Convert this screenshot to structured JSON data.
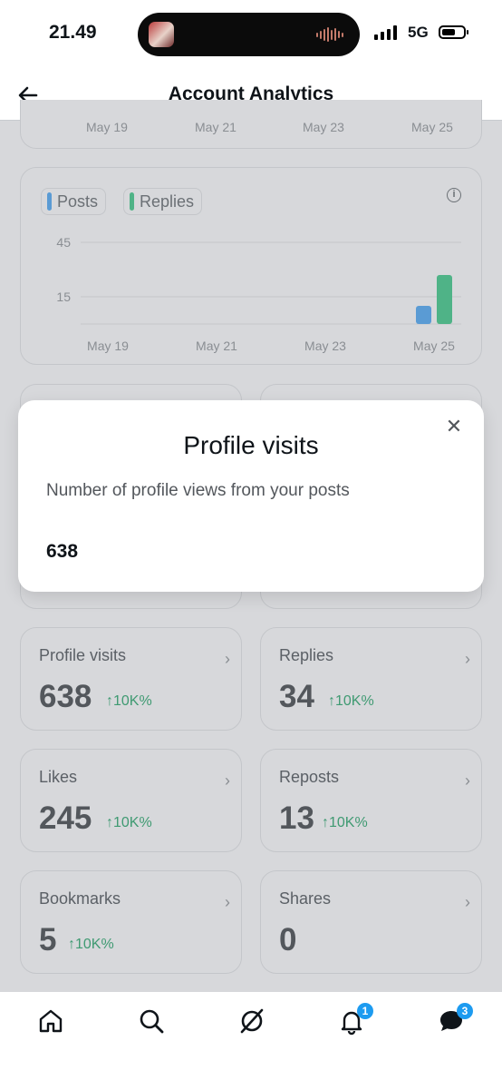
{
  "status_bar": {
    "time": "21.49",
    "network": "5G"
  },
  "header": {
    "title": "Account Analytics"
  },
  "top_chart_axis": {
    "x_ticks": [
      "May 19",
      "May 21",
      "May 23",
      "May 25"
    ]
  },
  "chart_data": {
    "type": "bar",
    "categories": [
      "May 19",
      "May 20",
      "May 21",
      "May 22",
      "May 23",
      "May 24",
      "May 25"
    ],
    "series": [
      {
        "name": "Posts",
        "values": [
          0,
          0,
          0,
          0,
          0,
          0,
          10
        ],
        "color": "#5a9bd4"
      },
      {
        "name": "Replies",
        "values": [
          0,
          0,
          0,
          0,
          0,
          0,
          27
        ],
        "color": "#4fb387"
      }
    ],
    "x_ticks": [
      "May 19",
      "May 21",
      "May 23",
      "May 25"
    ],
    "y_ticks": [
      "45",
      "15"
    ],
    "ylim": [
      0,
      45
    ],
    "grid": true,
    "legend_placement": "top-left"
  },
  "modal": {
    "title": "Profile visits",
    "description": "Number of profile views from your posts",
    "value": "638"
  },
  "stats": [
    {
      "label": "Profile visits",
      "value": "638",
      "change": "↑10K%"
    },
    {
      "label": "Replies",
      "value": "34",
      "change": "↑10K%"
    },
    {
      "label": "Likes",
      "value": "245",
      "change": "↑10K%"
    },
    {
      "label": "Reposts",
      "value": "13",
      "change": "↑10K%"
    },
    {
      "label": "Bookmarks",
      "value": "5",
      "change": "↑10K%"
    },
    {
      "label": "Shares",
      "value": "0",
      "change": ""
    }
  ],
  "tabbar": {
    "icons": [
      "home-icon",
      "search-icon",
      "grok-icon",
      "notifications-icon",
      "messages-icon"
    ],
    "notifications_badge": "1",
    "messages_badge": "3"
  },
  "colors": {
    "accent": "#1d9bf0",
    "positive": "#3f9a72",
    "posts": "#5a9bd4",
    "replies": "#4fb387"
  }
}
